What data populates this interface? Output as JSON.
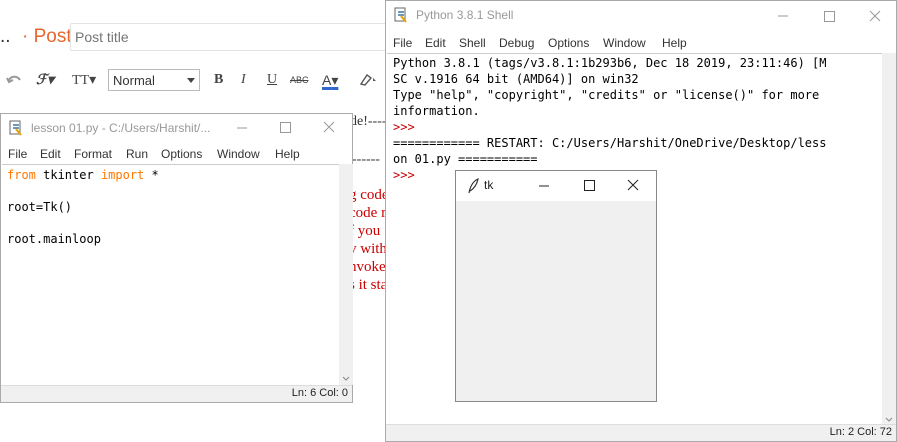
{
  "blog": {
    "dots": "..",
    "post_link": "· Post",
    "title_placeholder": "Post title",
    "format_value": "Normal",
    "bold": "B",
    "italic": "I",
    "underline": "U",
    "strike": "ABC",
    "font_color_letter": "A",
    "typeface_label": "TT",
    "body_lines": [
      "g code",
      "code r",
      "f you",
      "v with",
      "nvoke",
      "s it sta"
    ],
    "dash_line_1": "de!-----",
    "dash_line_2": "------",
    "icons": [
      "undo-icon",
      "font-icon",
      "font-size-icon",
      "highlight-icon"
    ]
  },
  "editor": {
    "title": "lesson 01.py - C:/Users/Harshit/...",
    "menu": [
      "File",
      "Edit",
      "Format",
      "Run",
      "Options",
      "Window",
      "Help"
    ],
    "code": {
      "line1_kw1": "from",
      "line1_mod": " tkinter ",
      "line1_kw2": "import",
      "line1_star": " *",
      "line2": "root=Tk()",
      "line3": "root.mainloop"
    },
    "status": "Ln: 6   Col: 0"
  },
  "shell": {
    "title": "Python 3.8.1 Shell",
    "menu": [
      "File",
      "Edit",
      "Shell",
      "Debug",
      "Options",
      "Window",
      "Help"
    ],
    "lines": [
      "Python 3.8.1 (tags/v3.8.1:1b293b6, Dec 18 2019, 23:11:46) [M",
      "SC v.1916 64 bit (AMD64)] on win32",
      "Type \"help\", \"copyright\", \"credits\" or \"license()\" for more",
      "information."
    ],
    "prompt": ">>>",
    "restart_1": "============ RESTART: C:/Users/Harshit/OneDrive/Desktop/less",
    "restart_2": "on 01.py ===========",
    "status": "Ln: 2   Col: 72"
  },
  "tk": {
    "title": "tk"
  }
}
